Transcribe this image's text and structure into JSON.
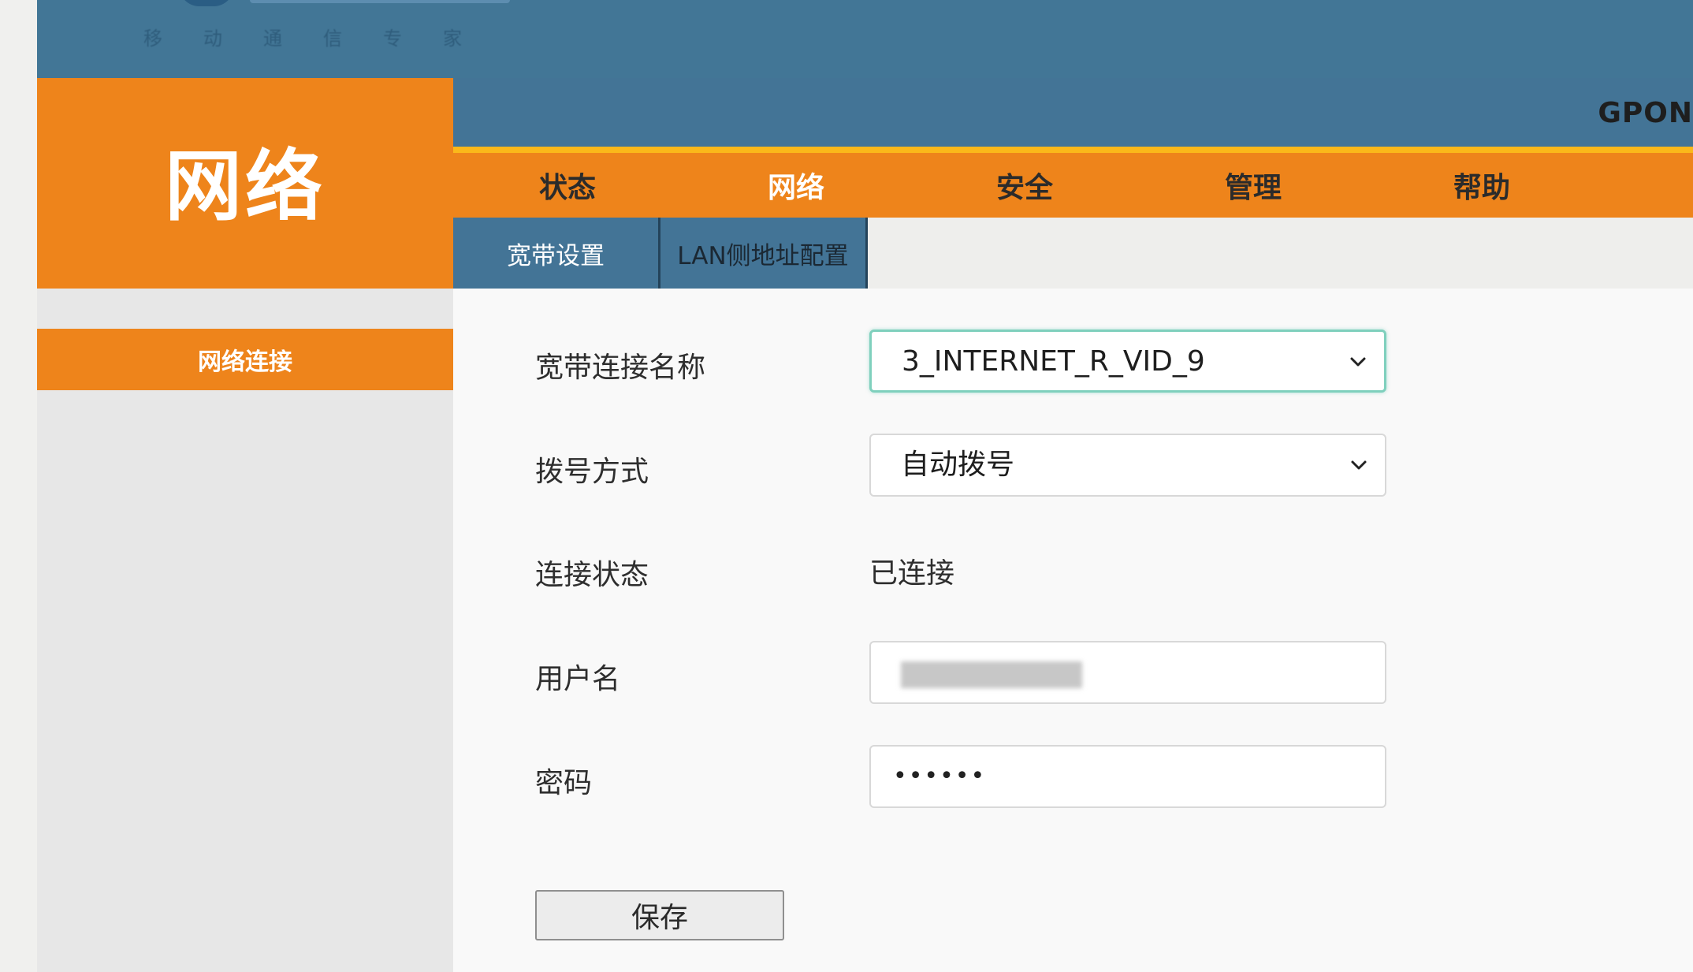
{
  "header": {
    "logo_tagline": [
      "移",
      "动",
      "通",
      "信",
      "专",
      "家"
    ],
    "product_name": "GPON"
  },
  "sidebar": {
    "title": "网络",
    "items": [
      {
        "label": "网络连接",
        "active": true
      }
    ]
  },
  "main_nav": {
    "items": [
      {
        "label": "状态",
        "active": false
      },
      {
        "label": "网络",
        "active": true
      },
      {
        "label": "安全",
        "active": false
      },
      {
        "label": "管理",
        "active": false
      },
      {
        "label": "帮助",
        "active": false
      }
    ]
  },
  "sub_nav": {
    "tabs": [
      {
        "label": "宽带设置",
        "active": true
      },
      {
        "label": "LAN侧地址配置",
        "active": false
      }
    ]
  },
  "form": {
    "connection_name_label": "宽带连接名称",
    "connection_name_value": "3_INTERNET_R_VID_9",
    "dial_mode_label": "拨号方式",
    "dial_mode_value": "自动拨号",
    "status_label": "连接状态",
    "status_value": "已连接",
    "username_label": "用户名",
    "password_label": "密码",
    "password_mask": "••••••",
    "save_label": "保存"
  },
  "colors": {
    "orange": "#ee841b",
    "blue": "#437496",
    "yellow": "#fbb81a",
    "focus_border": "#7fd0bd"
  }
}
